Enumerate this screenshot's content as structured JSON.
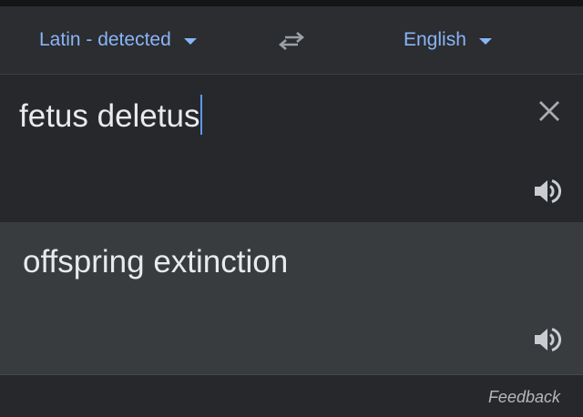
{
  "language_bar": {
    "source_language": "Latin - detected",
    "target_language": "English",
    "swap_icon": "swap-horiz-icon",
    "dropdown_icon": "arrow-drop-down-icon"
  },
  "input": {
    "text": "fetus deletus",
    "clear_icon": "close-icon",
    "speaker_icon": "volume-up-icon"
  },
  "output": {
    "text": "offspring extinction",
    "speaker_icon": "volume-up-icon"
  },
  "footer": {
    "feedback_label": "Feedback"
  },
  "colors": {
    "accent": "#8ab4f8",
    "cursor": "#5e97f6",
    "background": "#26282b",
    "output_background": "#383c3f",
    "text": "#e8eaed"
  }
}
